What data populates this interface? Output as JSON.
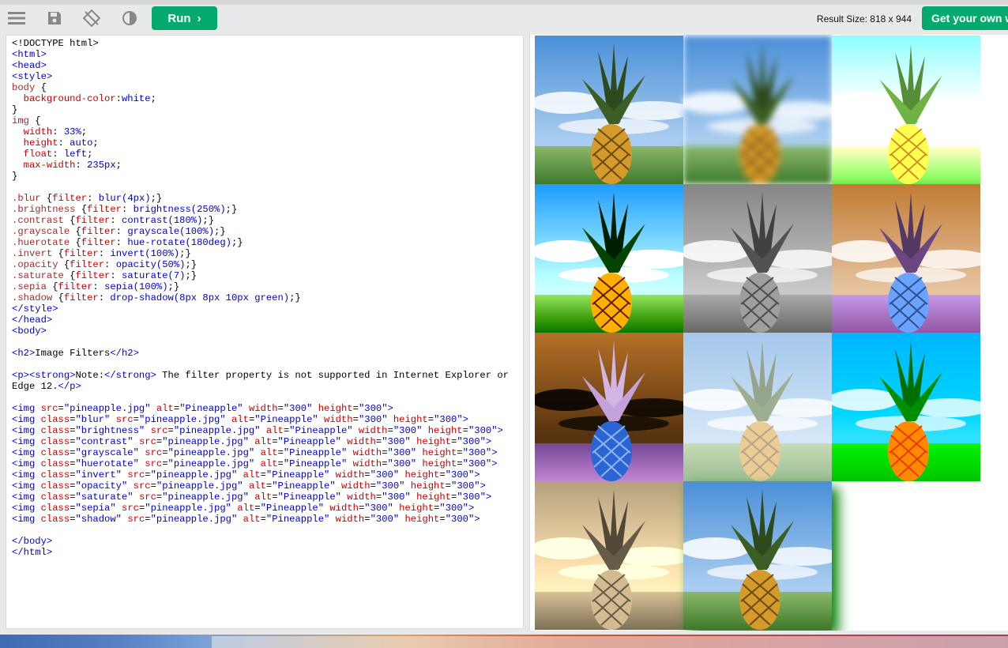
{
  "toolbar": {
    "menu_icon": "menu-icon",
    "save_icon": "save-icon",
    "rotate_icon": "rotate-layout-icon",
    "theme_icon": "contrast-theme-icon",
    "run_label": "Run",
    "result_size": "Result Size: 818 x 944",
    "get_own_label": "Get your own website"
  },
  "colors": {
    "accent": "#04aa6d",
    "tag": "#0000cd",
    "attr": "#cc0000",
    "selector": "#a52a2a"
  },
  "code_lines": [
    [
      [
        "",
        "<!DOCTYPE html>"
      ]
    ],
    [
      [
        "tag",
        "<html>"
      ]
    ],
    [
      [
        "tag",
        "<head>"
      ]
    ],
    [
      [
        "tag",
        "<style>"
      ]
    ],
    [
      [
        "sel",
        "body "
      ],
      [
        "",
        "{"
      ]
    ],
    [
      [
        "prop",
        "  background-color"
      ],
      [
        "",
        ":"
      ],
      [
        "val",
        "white"
      ],
      [
        "",
        ";"
      ]
    ],
    [
      [
        "",
        "}"
      ]
    ],
    [
      [
        "sel",
        "img "
      ],
      [
        "",
        "{"
      ]
    ],
    [
      [
        "prop",
        "  width"
      ],
      [
        "",
        ": "
      ],
      [
        "val",
        "33%"
      ],
      [
        "",
        ";"
      ]
    ],
    [
      [
        "prop",
        "  height"
      ],
      [
        "",
        ": "
      ],
      [
        "val",
        "auto"
      ],
      [
        "",
        ";"
      ]
    ],
    [
      [
        "prop",
        "  float"
      ],
      [
        "",
        ": "
      ],
      [
        "val",
        "left"
      ],
      [
        "",
        ";"
      ]
    ],
    [
      [
        "prop",
        "  max-width"
      ],
      [
        "",
        ": "
      ],
      [
        "val",
        "235px"
      ],
      [
        "",
        ";"
      ]
    ],
    [
      [
        "",
        "}"
      ]
    ],
    [
      [
        "",
        ""
      ]
    ],
    [
      [
        "sel",
        ".blur "
      ],
      [
        "",
        "{"
      ],
      [
        "prop",
        "filter"
      ],
      [
        "",
        ": "
      ],
      [
        "val",
        "blur(4px)"
      ],
      [
        "",
        ";}"
      ]
    ],
    [
      [
        "sel",
        ".brightness "
      ],
      [
        "",
        "{"
      ],
      [
        "prop",
        "filter"
      ],
      [
        "",
        ": "
      ],
      [
        "val",
        "brightness(250%)"
      ],
      [
        "",
        ";}"
      ]
    ],
    [
      [
        "sel",
        ".contrast "
      ],
      [
        "",
        "{"
      ],
      [
        "prop",
        "filter"
      ],
      [
        "",
        ": "
      ],
      [
        "val",
        "contrast(180%)"
      ],
      [
        "",
        ";}"
      ]
    ],
    [
      [
        "sel",
        ".grayscale "
      ],
      [
        "",
        "{"
      ],
      [
        "prop",
        "filter"
      ],
      [
        "",
        ": "
      ],
      [
        "val",
        "grayscale(100%)"
      ],
      [
        "",
        ";}"
      ]
    ],
    [
      [
        "sel",
        ".huerotate "
      ],
      [
        "",
        "{"
      ],
      [
        "prop",
        "filter"
      ],
      [
        "",
        ": "
      ],
      [
        "val",
        "hue-rotate(180deg)"
      ],
      [
        "",
        ";}"
      ]
    ],
    [
      [
        "sel",
        ".invert "
      ],
      [
        "",
        "{"
      ],
      [
        "prop",
        "filter"
      ],
      [
        "",
        ": "
      ],
      [
        "val",
        "invert(100%)"
      ],
      [
        "",
        ";}"
      ]
    ],
    [
      [
        "sel",
        ".opacity "
      ],
      [
        "",
        "{"
      ],
      [
        "prop",
        "filter"
      ],
      [
        "",
        ": "
      ],
      [
        "val",
        "opacity(50%)"
      ],
      [
        "",
        ";}"
      ]
    ],
    [
      [
        "sel",
        ".saturate "
      ],
      [
        "",
        "{"
      ],
      [
        "prop",
        "filter"
      ],
      [
        "",
        ": "
      ],
      [
        "val",
        "saturate(7)"
      ],
      [
        "",
        ";}"
      ]
    ],
    [
      [
        "sel",
        ".sepia "
      ],
      [
        "",
        "{"
      ],
      [
        "prop",
        "filter"
      ],
      [
        "",
        ": "
      ],
      [
        "val",
        "sepia(100%)"
      ],
      [
        "",
        ";}"
      ]
    ],
    [
      [
        "sel",
        ".shadow "
      ],
      [
        "",
        "{"
      ],
      [
        "prop",
        "filter"
      ],
      [
        "",
        ": "
      ],
      [
        "val",
        "drop-shadow(8px 8px 10px green)"
      ],
      [
        "",
        ";}"
      ]
    ],
    [
      [
        "tag",
        "</style>"
      ]
    ],
    [
      [
        "tag",
        "</head>"
      ]
    ],
    [
      [
        "tag",
        "<body>"
      ]
    ],
    [
      [
        "",
        ""
      ]
    ],
    [
      [
        "tag",
        "<h2>"
      ],
      [
        "",
        "Image Filters"
      ],
      [
        "tag",
        "</h2>"
      ]
    ],
    [
      [
        "",
        ""
      ]
    ],
    [
      [
        "tag",
        "<p><strong>"
      ],
      [
        "",
        "Note:"
      ],
      [
        "tag",
        "</strong>"
      ],
      [
        "",
        " The filter property is not supported in Internet Explorer or"
      ]
    ],
    [
      [
        "",
        "Edge 12."
      ],
      [
        "tag",
        "</p>"
      ]
    ],
    [
      [
        "",
        ""
      ]
    ],
    [
      [
        "tag",
        "<img "
      ],
      [
        "atn",
        "src"
      ],
      [
        "",
        "="
      ],
      [
        "atv",
        "\"pineapple.jpg\" "
      ],
      [
        "atn",
        "alt"
      ],
      [
        "",
        "="
      ],
      [
        "atv",
        "\"Pineapple\" "
      ],
      [
        "atn",
        "width"
      ],
      [
        "",
        "="
      ],
      [
        "atv",
        "\"300\" "
      ],
      [
        "atn",
        "height"
      ],
      [
        "",
        "="
      ],
      [
        "atv",
        "\"300\""
      ],
      [
        "tag",
        ">"
      ]
    ],
    [
      [
        "tag",
        "<img "
      ],
      [
        "atn",
        "class"
      ],
      [
        "",
        "="
      ],
      [
        "atv",
        "\"blur\" "
      ],
      [
        "atn",
        "src"
      ],
      [
        "",
        "="
      ],
      [
        "atv",
        "\"pineapple.jpg\" "
      ],
      [
        "atn",
        "alt"
      ],
      [
        "",
        "="
      ],
      [
        "atv",
        "\"Pineapple\" "
      ],
      [
        "atn",
        "width"
      ],
      [
        "",
        "="
      ],
      [
        "atv",
        "\"300\" "
      ],
      [
        "atn",
        "height"
      ],
      [
        "",
        "="
      ],
      [
        "atv",
        "\"300\""
      ],
      [
        "tag",
        ">"
      ]
    ],
    [
      [
        "tag",
        "<img "
      ],
      [
        "atn",
        "class"
      ],
      [
        "",
        "="
      ],
      [
        "atv",
        "\"brightness\" "
      ],
      [
        "atn",
        "src"
      ],
      [
        "",
        "="
      ],
      [
        "atv",
        "\"pineapple.jpg\" "
      ],
      [
        "atn",
        "alt"
      ],
      [
        "",
        "="
      ],
      [
        "atv",
        "\"Pineapple\" "
      ],
      [
        "atn",
        "width"
      ],
      [
        "",
        "="
      ],
      [
        "atv",
        "\"300\" "
      ],
      [
        "atn",
        "height"
      ],
      [
        "",
        "="
      ],
      [
        "atv",
        "\"300\""
      ],
      [
        "tag",
        ">"
      ]
    ],
    [
      [
        "tag",
        "<img "
      ],
      [
        "atn",
        "class"
      ],
      [
        "",
        "="
      ],
      [
        "atv",
        "\"contrast\" "
      ],
      [
        "atn",
        "src"
      ],
      [
        "",
        "="
      ],
      [
        "atv",
        "\"pineapple.jpg\" "
      ],
      [
        "atn",
        "alt"
      ],
      [
        "",
        "="
      ],
      [
        "atv",
        "\"Pineapple\" "
      ],
      [
        "atn",
        "width"
      ],
      [
        "",
        "="
      ],
      [
        "atv",
        "\"300\" "
      ],
      [
        "atn",
        "height"
      ],
      [
        "",
        "="
      ],
      [
        "atv",
        "\"300\""
      ],
      [
        "tag",
        ">"
      ]
    ],
    [
      [
        "tag",
        "<img "
      ],
      [
        "atn",
        "class"
      ],
      [
        "",
        "="
      ],
      [
        "atv",
        "\"grayscale\" "
      ],
      [
        "atn",
        "src"
      ],
      [
        "",
        "="
      ],
      [
        "atv",
        "\"pineapple.jpg\" "
      ],
      [
        "atn",
        "alt"
      ],
      [
        "",
        "="
      ],
      [
        "atv",
        "\"Pineapple\" "
      ],
      [
        "atn",
        "width"
      ],
      [
        "",
        "="
      ],
      [
        "atv",
        "\"300\" "
      ],
      [
        "atn",
        "height"
      ],
      [
        "",
        "="
      ],
      [
        "atv",
        "\"300\""
      ],
      [
        "tag",
        ">"
      ]
    ],
    [
      [
        "tag",
        "<img "
      ],
      [
        "atn",
        "class"
      ],
      [
        "",
        "="
      ],
      [
        "atv",
        "\"huerotate\" "
      ],
      [
        "atn",
        "src"
      ],
      [
        "",
        "="
      ],
      [
        "atv",
        "\"pineapple.jpg\" "
      ],
      [
        "atn",
        "alt"
      ],
      [
        "",
        "="
      ],
      [
        "atv",
        "\"Pineapple\" "
      ],
      [
        "atn",
        "width"
      ],
      [
        "",
        "="
      ],
      [
        "atv",
        "\"300\" "
      ],
      [
        "atn",
        "height"
      ],
      [
        "",
        "="
      ],
      [
        "atv",
        "\"300\""
      ],
      [
        "tag",
        ">"
      ]
    ],
    [
      [
        "tag",
        "<img "
      ],
      [
        "atn",
        "class"
      ],
      [
        "",
        "="
      ],
      [
        "atv",
        "\"invert\" "
      ],
      [
        "atn",
        "src"
      ],
      [
        "",
        "="
      ],
      [
        "atv",
        "\"pineapple.jpg\" "
      ],
      [
        "atn",
        "alt"
      ],
      [
        "",
        "="
      ],
      [
        "atv",
        "\"Pineapple\" "
      ],
      [
        "atn",
        "width"
      ],
      [
        "",
        "="
      ],
      [
        "atv",
        "\"300\" "
      ],
      [
        "atn",
        "height"
      ],
      [
        "",
        "="
      ],
      [
        "atv",
        "\"300\""
      ],
      [
        "tag",
        ">"
      ]
    ],
    [
      [
        "tag",
        "<img "
      ],
      [
        "atn",
        "class"
      ],
      [
        "",
        "="
      ],
      [
        "atv",
        "\"opacity\" "
      ],
      [
        "atn",
        "src"
      ],
      [
        "",
        "="
      ],
      [
        "atv",
        "\"pineapple.jpg\" "
      ],
      [
        "atn",
        "alt"
      ],
      [
        "",
        "="
      ],
      [
        "atv",
        "\"Pineapple\" "
      ],
      [
        "atn",
        "width"
      ],
      [
        "",
        "="
      ],
      [
        "atv",
        "\"300\" "
      ],
      [
        "atn",
        "height"
      ],
      [
        "",
        "="
      ],
      [
        "atv",
        "\"300\""
      ],
      [
        "tag",
        ">"
      ]
    ],
    [
      [
        "tag",
        "<img "
      ],
      [
        "atn",
        "class"
      ],
      [
        "",
        "="
      ],
      [
        "atv",
        "\"saturate\" "
      ],
      [
        "atn",
        "src"
      ],
      [
        "",
        "="
      ],
      [
        "atv",
        "\"pineapple.jpg\" "
      ],
      [
        "atn",
        "alt"
      ],
      [
        "",
        "="
      ],
      [
        "atv",
        "\"Pineapple\" "
      ],
      [
        "atn",
        "width"
      ],
      [
        "",
        "="
      ],
      [
        "atv",
        "\"300\" "
      ],
      [
        "atn",
        "height"
      ],
      [
        "",
        "="
      ],
      [
        "atv",
        "\"300\""
      ],
      [
        "tag",
        ">"
      ]
    ],
    [
      [
        "tag",
        "<img "
      ],
      [
        "atn",
        "class"
      ],
      [
        "",
        "="
      ],
      [
        "atv",
        "\"sepia\" "
      ],
      [
        "atn",
        "src"
      ],
      [
        "",
        "="
      ],
      [
        "atv",
        "\"pineapple.jpg\" "
      ],
      [
        "atn",
        "alt"
      ],
      [
        "",
        "="
      ],
      [
        "atv",
        "\"Pineapple\" "
      ],
      [
        "atn",
        "width"
      ],
      [
        "",
        "="
      ],
      [
        "atv",
        "\"300\" "
      ],
      [
        "atn",
        "height"
      ],
      [
        "",
        "="
      ],
      [
        "atv",
        "\"300\""
      ],
      [
        "tag",
        ">"
      ]
    ],
    [
      [
        "tag",
        "<img "
      ],
      [
        "atn",
        "class"
      ],
      [
        "",
        "="
      ],
      [
        "atv",
        "\"shadow\" "
      ],
      [
        "atn",
        "src"
      ],
      [
        "",
        "="
      ],
      [
        "atv",
        "\"pineapple.jpg\" "
      ],
      [
        "atn",
        "alt"
      ],
      [
        "",
        "="
      ],
      [
        "atv",
        "\"Pineapple\" "
      ],
      [
        "atn",
        "width"
      ],
      [
        "",
        "="
      ],
      [
        "atv",
        "\"300\" "
      ],
      [
        "atn",
        "height"
      ],
      [
        "",
        "="
      ],
      [
        "atv",
        "\"300\""
      ],
      [
        "tag",
        ">"
      ]
    ],
    [
      [
        "",
        ""
      ]
    ],
    [
      [
        "tag",
        "</body>"
      ]
    ],
    [
      [
        "tag",
        "</html>"
      ]
    ]
  ],
  "result_images": [
    {
      "filter": "none"
    },
    {
      "filter": "blur"
    },
    {
      "filter": "brightness"
    },
    {
      "filter": "contrast"
    },
    {
      "filter": "grayscale"
    },
    {
      "filter": "huerotate"
    },
    {
      "filter": "invert"
    },
    {
      "filter": "opacity"
    },
    {
      "filter": "saturate"
    },
    {
      "filter": "sepia"
    },
    {
      "filter": "shadow"
    }
  ]
}
